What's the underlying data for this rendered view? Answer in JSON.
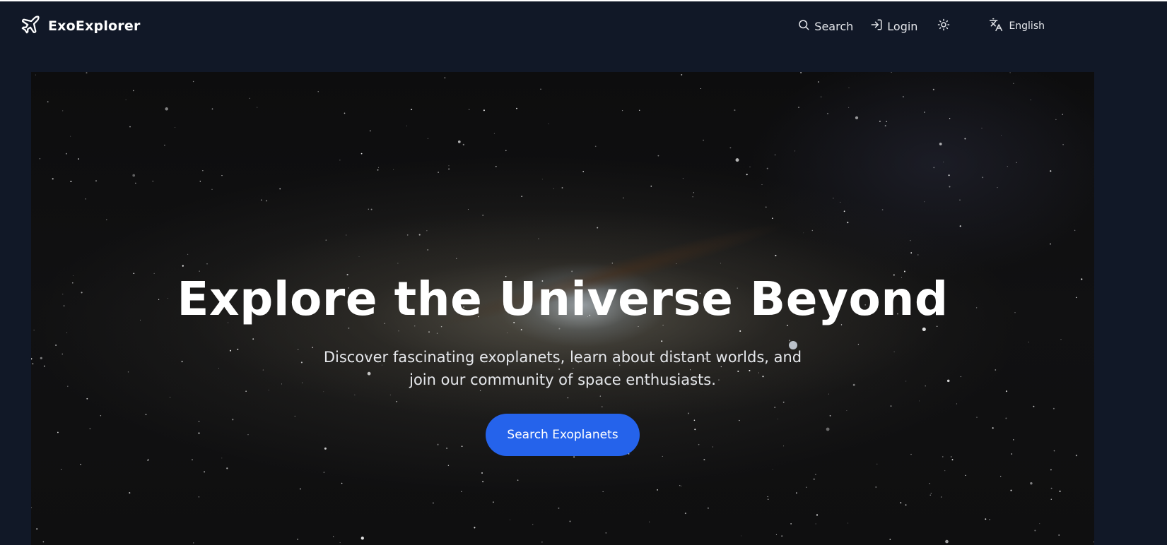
{
  "navbar": {
    "brand_name": "ExoExplorer",
    "search_label": "Search",
    "login_label": "Login",
    "language_label": "English"
  },
  "hero": {
    "title": "Explore the Universe Beyond",
    "subtitle": "Discover fascinating exoplanets, learn about distant worlds, and join our community of space enthusiasts.",
    "cta_label": "Search Exoplanets"
  },
  "colors": {
    "background": "#111827",
    "accent": "#2563eb",
    "text": "#ffffff"
  },
  "icons": {
    "brand": "plane-icon",
    "search": "search-icon",
    "login": "login-icon",
    "theme": "sun-icon",
    "language": "translate-icon"
  }
}
